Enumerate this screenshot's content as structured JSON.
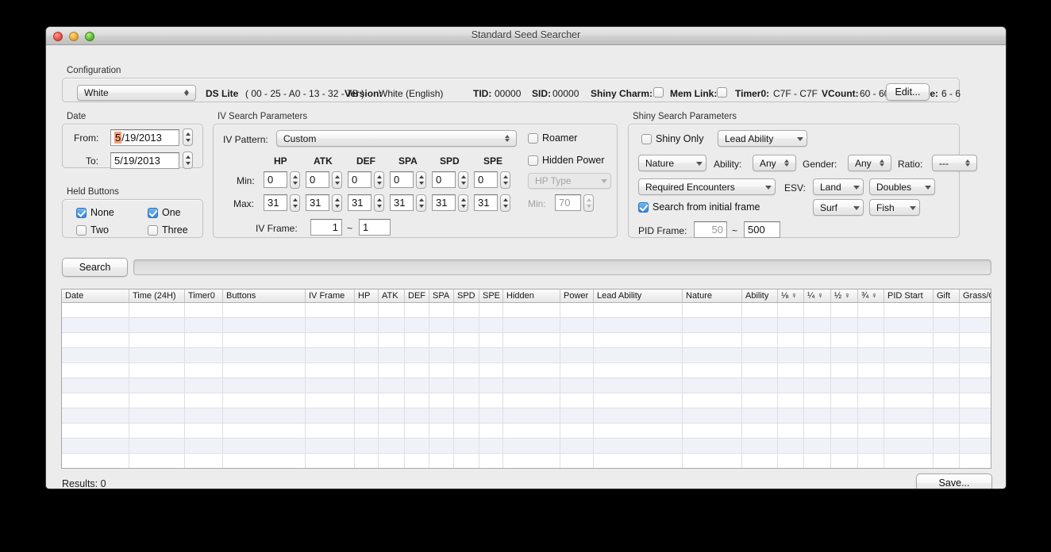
{
  "window": {
    "title": "Standard Seed Searcher"
  },
  "configuration": {
    "legend": "Configuration",
    "profile": "White",
    "console": "DS Lite",
    "mac": "( 00 - 25 - A0 - 13 - 32 - 7B )",
    "version_label": "Version:",
    "version_value": "White (English)",
    "tid_label": "TID:",
    "tid_value": "00000",
    "sid_label": "SID:",
    "sid_value": "00000",
    "shiny_charm_label": "Shiny Charm:",
    "shiny_charm_checked": false,
    "mem_link_label": "Mem Link:",
    "mem_link_checked": false,
    "timer0_label": "Timer0:",
    "timer0_value": "C7F - C7F",
    "vcount_label": "VCount:",
    "vcount_value": "60 - 60",
    "vframe_label": "VFrame:",
    "vframe_value": "6 - 6",
    "edit_button": "Edit..."
  },
  "date": {
    "legend": "Date",
    "from_label": "From:",
    "from_sel": "5",
    "from_rest": "/19/2013",
    "to_label": "To:",
    "to_value": "5/19/2013"
  },
  "held_buttons": {
    "legend": "Held Buttons",
    "items": [
      {
        "label": "None",
        "checked": true
      },
      {
        "label": "One",
        "checked": true
      },
      {
        "label": "Two",
        "checked": false
      },
      {
        "label": "Three",
        "checked": false
      }
    ]
  },
  "iv_search": {
    "legend": "IV Search Parameters",
    "pattern_label": "IV Pattern:",
    "pattern_value": "Custom",
    "stat_headers": [
      "HP",
      "ATK",
      "DEF",
      "SPA",
      "SPD",
      "SPE"
    ],
    "min_label": "Min:",
    "min_values": [
      "0",
      "0",
      "0",
      "0",
      "0",
      "0"
    ],
    "max_label": "Max:",
    "max_values": [
      "31",
      "31",
      "31",
      "31",
      "31",
      "31"
    ],
    "iv_frame_label": "IV Frame:",
    "iv_frame_from": "1",
    "iv_frame_tilde": "~",
    "iv_frame_to": "1",
    "roamer_label": "Roamer",
    "roamer_checked": false,
    "hidden_power_label": "Hidden Power",
    "hidden_power_checked": false,
    "hp_type_value": "HP Type",
    "hp_min_label": "Min:",
    "hp_min_value": "70"
  },
  "shiny_search": {
    "legend": "Shiny Search Parameters",
    "shiny_only_label": "Shiny Only",
    "shiny_only_checked": false,
    "lead_ability_value": "Lead Ability",
    "nature_value": "Nature",
    "ability_label": "Ability:",
    "ability_value": "Any",
    "gender_label": "Gender:",
    "gender_value": "Any",
    "ratio_label": "Ratio:",
    "ratio_value": "---",
    "required_encounters_value": "Required Encounters",
    "esv_label": "ESV:",
    "esv_land": "Land",
    "esv_doubles": "Doubles",
    "esv_surf": "Surf",
    "esv_fish": "Fish",
    "initial_frame_label": "Search from initial frame",
    "initial_frame_checked": true,
    "pid_frame_label": "PID Frame:",
    "pid_frame_from": "50",
    "pid_frame_tilde": "~",
    "pid_frame_to": "500"
  },
  "actions": {
    "search_button": "Search",
    "save_button": "Save...",
    "results_label": "Results: 0",
    "progress_value": 0
  },
  "results_table": {
    "columns": [
      {
        "label": "Date",
        "width": 85
      },
      {
        "label": "Time (24H)",
        "width": 70
      },
      {
        "label": "Timer0",
        "width": 48
      },
      {
        "label": "Buttons",
        "width": 104
      },
      {
        "label": "IV Frame",
        "width": 62
      },
      {
        "label": "HP",
        "width": 30
      },
      {
        "label": "ATK",
        "width": 33
      },
      {
        "label": "DEF",
        "width": 31
      },
      {
        "label": "SPA",
        "width": 31
      },
      {
        "label": "SPD",
        "width": 32
      },
      {
        "label": "SPE",
        "width": 30
      },
      {
        "label": "Hidden",
        "width": 72
      },
      {
        "label": "Power",
        "width": 42
      },
      {
        "label": "Lead Ability",
        "width": 112
      },
      {
        "label": "Nature",
        "width": 75
      },
      {
        "label": "Ability",
        "width": 45
      },
      {
        "label": "⅛ ♀",
        "width": 33
      },
      {
        "label": "¼ ♀",
        "width": 34
      },
      {
        "label": "½ ♀",
        "width": 34
      },
      {
        "label": "¾ ♀",
        "width": 33
      },
      {
        "label": "PID Start",
        "width": 62
      },
      {
        "label": "Gift",
        "width": 33
      },
      {
        "label": "Grass/C",
        "width": 70
      }
    ],
    "row_count": 11,
    "rows": []
  }
}
